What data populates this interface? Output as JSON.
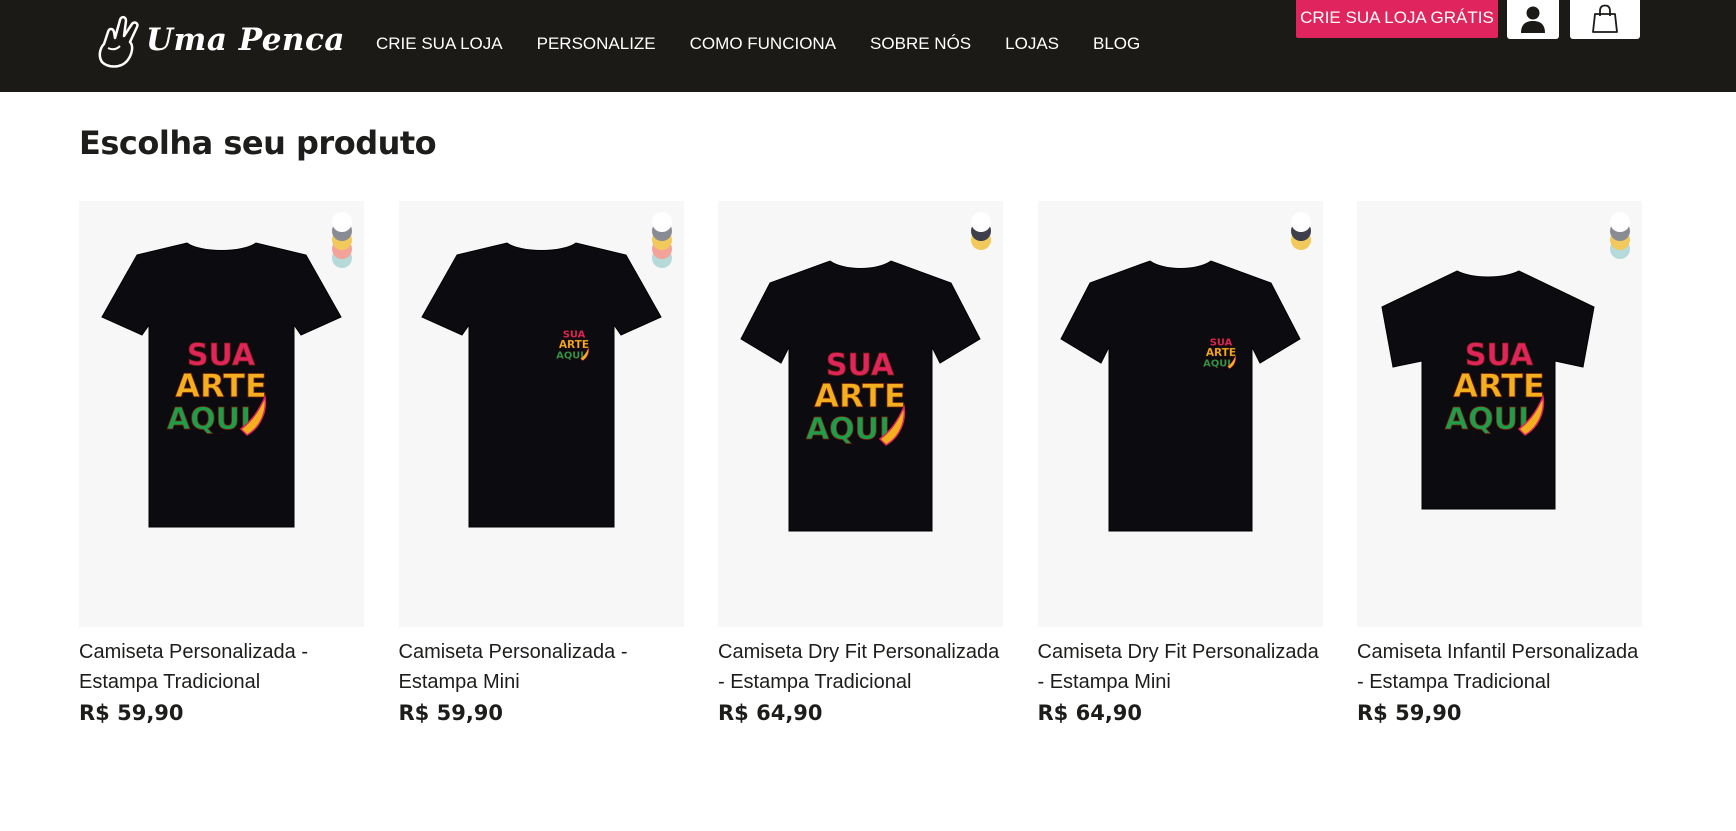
{
  "brand": {
    "name": "Uma Penca",
    "logo_icon": "hand-peace-icon"
  },
  "nav": {
    "items": [
      "CRIE SUA LOJA",
      "PERSONALIZE",
      "COMO FUNCIONA",
      "SOBRE NÓS",
      "LOJAS",
      "BLOG"
    ]
  },
  "header_actions": {
    "cta_label": "CRIE SUA LOJA GRÁTIS",
    "cta_color": "#e0245e",
    "user_icon": "user-icon",
    "bag_icon": "shopping-bag-icon"
  },
  "page": {
    "title": "Escolha seu produto"
  },
  "print_text": [
    "SUA",
    "ARTE",
    "AQUI"
  ],
  "products": [
    {
      "name": "Camiseta Personalizada - Estampa Tradicional",
      "price": "R$ 59,90",
      "style": "regular",
      "print": "full",
      "swatches": [
        "#ffffff",
        "#8a8c94",
        "#f2c95c",
        "#f3a39a",
        "#b6d9da"
      ]
    },
    {
      "name": "Camiseta Personalizada - Estampa Mini",
      "price": "R$ 59,90",
      "style": "regular",
      "print": "mini",
      "swatches": [
        "#ffffff",
        "#8a8c94",
        "#f2c95c",
        "#f3a39a",
        "#b6d9da"
      ]
    },
    {
      "name": "Camiseta Dry Fit Personalizada - Estampa Tradicional",
      "price": "R$ 64,90",
      "style": "dryfit",
      "print": "full",
      "swatches": [
        "#ffffff",
        "#3d3f4a",
        "#f2c95c"
      ]
    },
    {
      "name": "Camiseta Dry Fit Personalizada - Estampa Mini",
      "price": "R$ 64,90",
      "style": "dryfit",
      "print": "mini",
      "swatches": [
        "#ffffff",
        "#3d3f4a",
        "#f2c95c"
      ]
    },
    {
      "name": "Camiseta Infantil Personalizada - Estampa Tradicional",
      "price": "R$ 59,90",
      "style": "kids",
      "print": "full",
      "swatches": [
        "#ffffff",
        "#8a8c94",
        "#f2c95c",
        "#b6d9da"
      ]
    }
  ]
}
